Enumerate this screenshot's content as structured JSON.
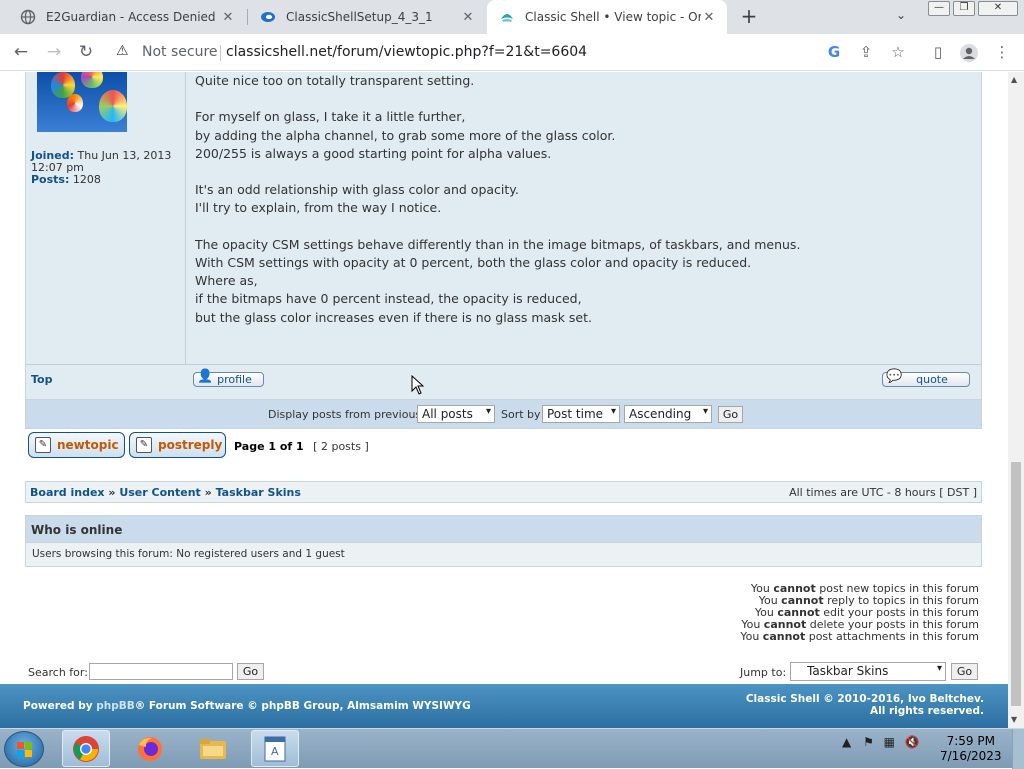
{
  "browser": {
    "tabs": [
      {
        "title": "E2Guardian - Access Denied",
        "icon": "globe-icon"
      },
      {
        "title": "ClassicShellSetup_4_3_1",
        "icon": "download-icon"
      },
      {
        "title": "Classic Shell • View topic - Origin",
        "icon": "classicshell-icon"
      }
    ],
    "new_tab_glyph": "+",
    "security_label": "Not secure",
    "url": "classicshell.net/forum/viewtopic.php?f=21&t=6604"
  },
  "post": {
    "joined_label": "Joined:",
    "joined_value": "Thu Jun 13, 2013",
    "joined_time": "12:07 pm",
    "posts_label": "Posts:",
    "posts_value": "1208",
    "lines": [
      "Quite nice too on totally transparent setting.",
      "For myself on glass, I take it a little further,",
      "by adding the alpha channel, to grab some more of the glass color.",
      "200/255 is always a good starting point for alpha values.",
      "It's an odd relationship with glass color and opacity.",
      "I'll try to explain, from the way I notice.",
      "The opacity CSM settings behave differently than in the image bitmaps, of taskbars, and menus.",
      "With CSM settings with opacity at 0 percent, both the glass color and opacity is reduced.",
      "Where as,",
      "if the bitmaps have 0 percent instead, the opacity is reduced,",
      "but the glass color increases even if there is no glass mask set."
    ],
    "top_link": "Top",
    "profile_button": "profile",
    "quote_button": "quote"
  },
  "sort": {
    "display_label": "Display posts from previous:",
    "display_value": "All posts",
    "sortby_label": "Sort by",
    "sortby_value": "Post time",
    "order_value": "Ascending",
    "go": "Go"
  },
  "actions": {
    "newtopic": "newtopic",
    "postreply": "postreply",
    "page_info": "Page 1 of 1",
    "posts_count": "[ 2 posts ]"
  },
  "breadcrumbs": {
    "items": [
      "Board index",
      "User Content",
      "Taskbar Skins"
    ],
    "separator": "»",
    "timezone": "All times are UTC - 8 hours [ DST ]"
  },
  "online": {
    "heading": "Who is online",
    "text": "Users browsing this forum: No registered users and 1 guest"
  },
  "permissions": [
    {
      "pre": "You ",
      "em": "cannot",
      "post": " post new topics in this forum"
    },
    {
      "pre": "You ",
      "em": "cannot",
      "post": " reply to topics in this forum"
    },
    {
      "pre": "You ",
      "em": "cannot",
      "post": " edit your posts in this forum"
    },
    {
      "pre": "You ",
      "em": "cannot",
      "post": " delete your posts in this forum"
    },
    {
      "pre": "You ",
      "em": "cannot",
      "post": " post attachments in this forum"
    }
  ],
  "search": {
    "label": "Search for:",
    "go": "Go"
  },
  "jump": {
    "label": "Jump to:",
    "value": "Taskbar Skins",
    "go": "Go"
  },
  "footer": {
    "powered_pre": "Powered by ",
    "powered_link": "phpBB",
    "powered_post": "® Forum Software © phpBB Group, Almsamim WYSIWYG",
    "copyright_line1": "Classic Shell © 2010-2016, Ivo Beltchev.",
    "copyright_line2": "All rights reserved."
  },
  "taskbar": {
    "time": "7:59 PM",
    "date": "7/16/2023"
  },
  "colors": {
    "post_bg": "#e1ebf2",
    "link": "#105289",
    "footer": "#2b6fa0"
  }
}
